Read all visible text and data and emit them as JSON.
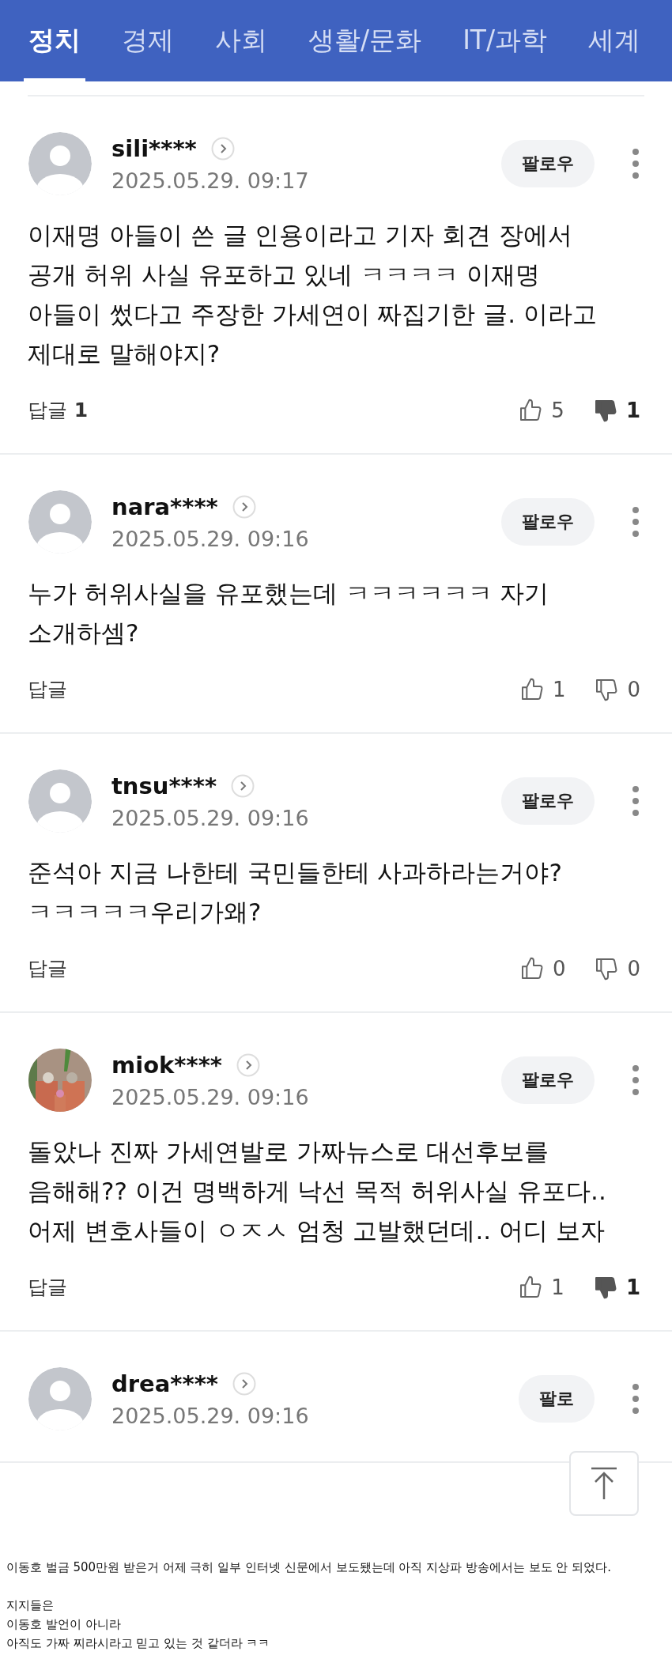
{
  "tabs": [
    {
      "label": "정치",
      "selected": true
    },
    {
      "label": "경제",
      "selected": false
    },
    {
      "label": "사회",
      "selected": false
    },
    {
      "label": "생활/문화",
      "selected": false
    },
    {
      "label": "IT/과학",
      "selected": false
    },
    {
      "label": "세계",
      "selected": false
    }
  ],
  "comments": [
    {
      "user": "sili****",
      "date": "2025.05.29. 09:17",
      "follow": "팔로우",
      "avatar": {
        "kind": "default"
      },
      "body": "이재명 아들이 쓴 글 인용이라고 기자 회견 장에서 공개 허위 사실 유포하고 있네 ㅋㅋㅋㅋ 이재명 아들이 썼다고 주장한 가세연이 짜집기한 글. 이라고 제대로 말해야지?",
      "reply_label": "답글",
      "reply_count": "1",
      "likes": "5",
      "dislikes": "1",
      "dislike_active": true
    },
    {
      "user": "nara****",
      "date": "2025.05.29. 09:16",
      "follow": "팔로우",
      "avatar": {
        "kind": "default"
      },
      "body": "누가 허위사실을 유포했는데 ㅋㅋㅋㅋㅋㅋ 자기 소개하셈?",
      "reply_label": "답글",
      "likes": "1",
      "dislikes": "0",
      "dislike_active": false
    },
    {
      "user": "tnsu****",
      "date": "2025.05.29. 09:16",
      "follow": "팔로우",
      "avatar": {
        "kind": "default"
      },
      "body": "준석아 지금 나한테 국민들한테 사과하라는거야? ㅋㅋㅋㅋㅋ우리가왜?",
      "reply_label": "답글",
      "likes": "0",
      "dislikes": "0",
      "dislike_active": false
    },
    {
      "user": "miok****",
      "date": "2025.05.29. 09:16",
      "follow": "팔로우",
      "body": "돌았나 진짜 가세연발로 가짜뉴스로 대선후보를 음해해?? 이건 명백하게 낙선 목적 허위사실 유포다.. 어제 변호사들이 ㅇㅈㅅ 엄청 고발했던데.. 어디 보자",
      "reply_label": "답글",
      "likes": "1",
      "dislikes": "1",
      "dislike_active": true
    },
    {
      "user": "drea****",
      "date": "2025.05.29. 09:16",
      "follow": "팔로",
      "avatar": {
        "kind": "default"
      }
    }
  ],
  "caption": {
    "paragraphs": [
      [
        "이동호 벌금 500만원 받은거 어제 극히 일부 인터넷 신문에서 보도됐는데 아직 지상파 방송에서는 보도 안 되었다."
      ],
      [
        "지지들은",
        "이동호 발언이 아니라",
        "아직도 가짜 찌라시라고 믿고 있는 것 같더라 ㅋㅋ"
      ]
    ]
  }
}
